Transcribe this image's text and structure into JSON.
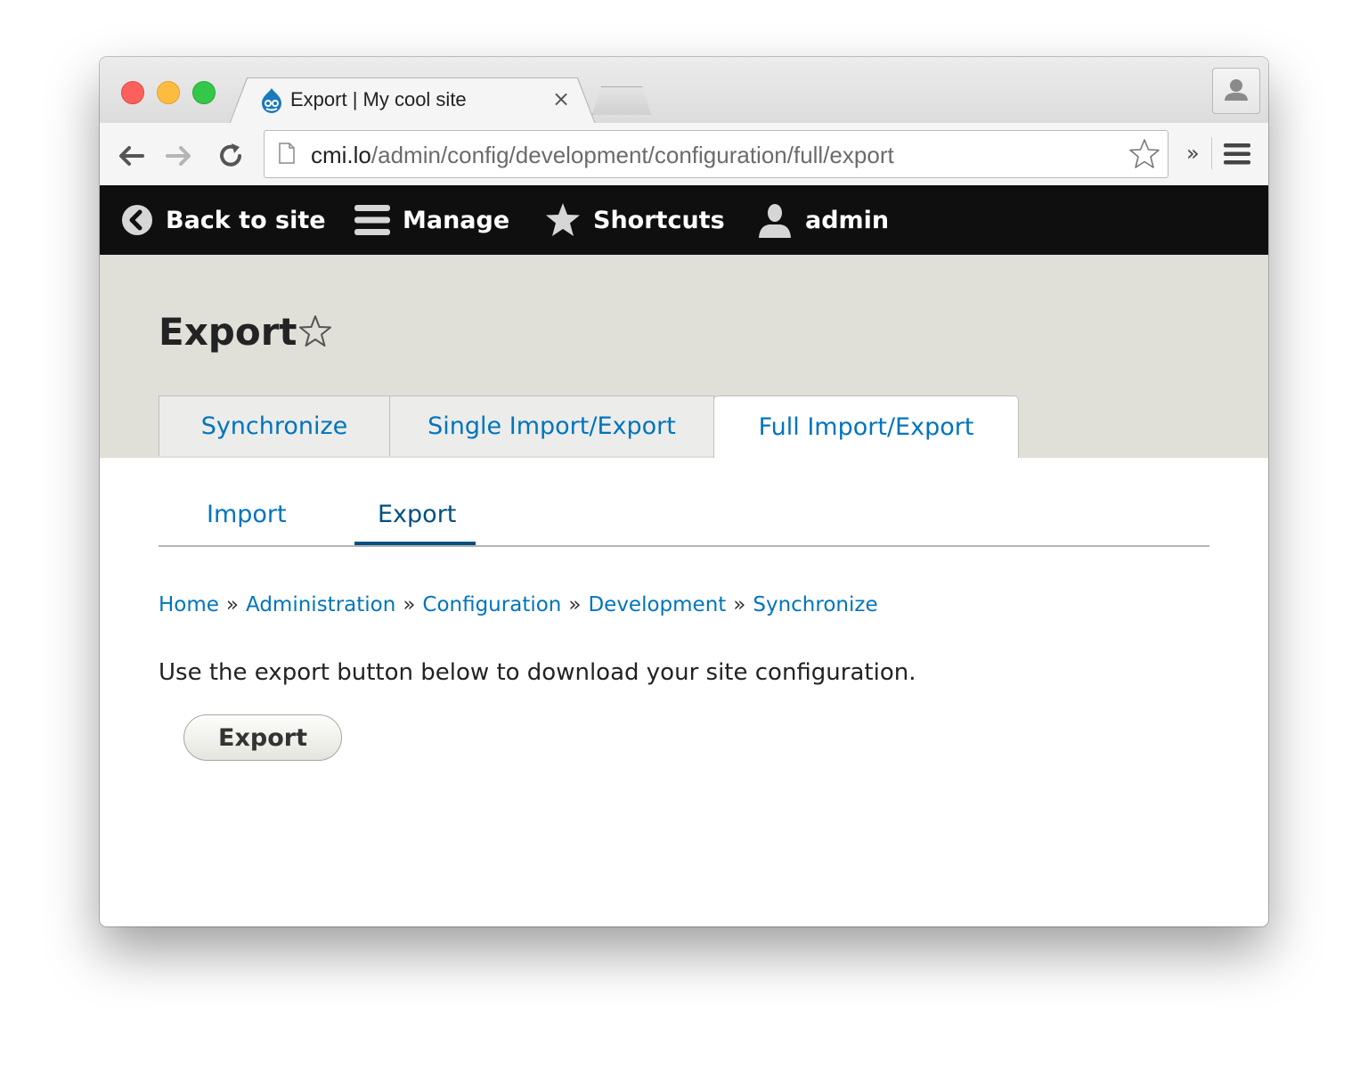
{
  "browser": {
    "tab_title": "Export | My cool site",
    "tab_close": "×",
    "url_host": "cmi.lo",
    "url_path": "/admin/config/development/configuration/full/export",
    "overflow_label": "»"
  },
  "toolbar": {
    "back_to_site": "Back to site",
    "manage": "Manage",
    "shortcuts": "Shortcuts",
    "user": "admin"
  },
  "page": {
    "title": "Export",
    "primary_tabs": [
      {
        "label": "Synchronize"
      },
      {
        "label": "Single Import/Export"
      },
      {
        "label": "Full Import/Export"
      }
    ],
    "secondary_tabs": [
      {
        "label": "Import"
      },
      {
        "label": "Export"
      }
    ],
    "breadcrumb": [
      "Home",
      "Administration",
      "Configuration",
      "Development",
      "Synchronize"
    ],
    "breadcrumb_separator": "»",
    "description": "Use the export button below to download your site configuration.",
    "export_button": "Export"
  },
  "colors": {
    "link": "#0074bd",
    "toolbar_bg": "#0f0f0f",
    "header_bg": "#e0e0d8"
  },
  "icons": {
    "favicon": "drupal-drop-icon",
    "back": "back-circle-icon",
    "manage": "hamburger-icon",
    "shortcuts": "star-icon",
    "user": "user-icon"
  }
}
